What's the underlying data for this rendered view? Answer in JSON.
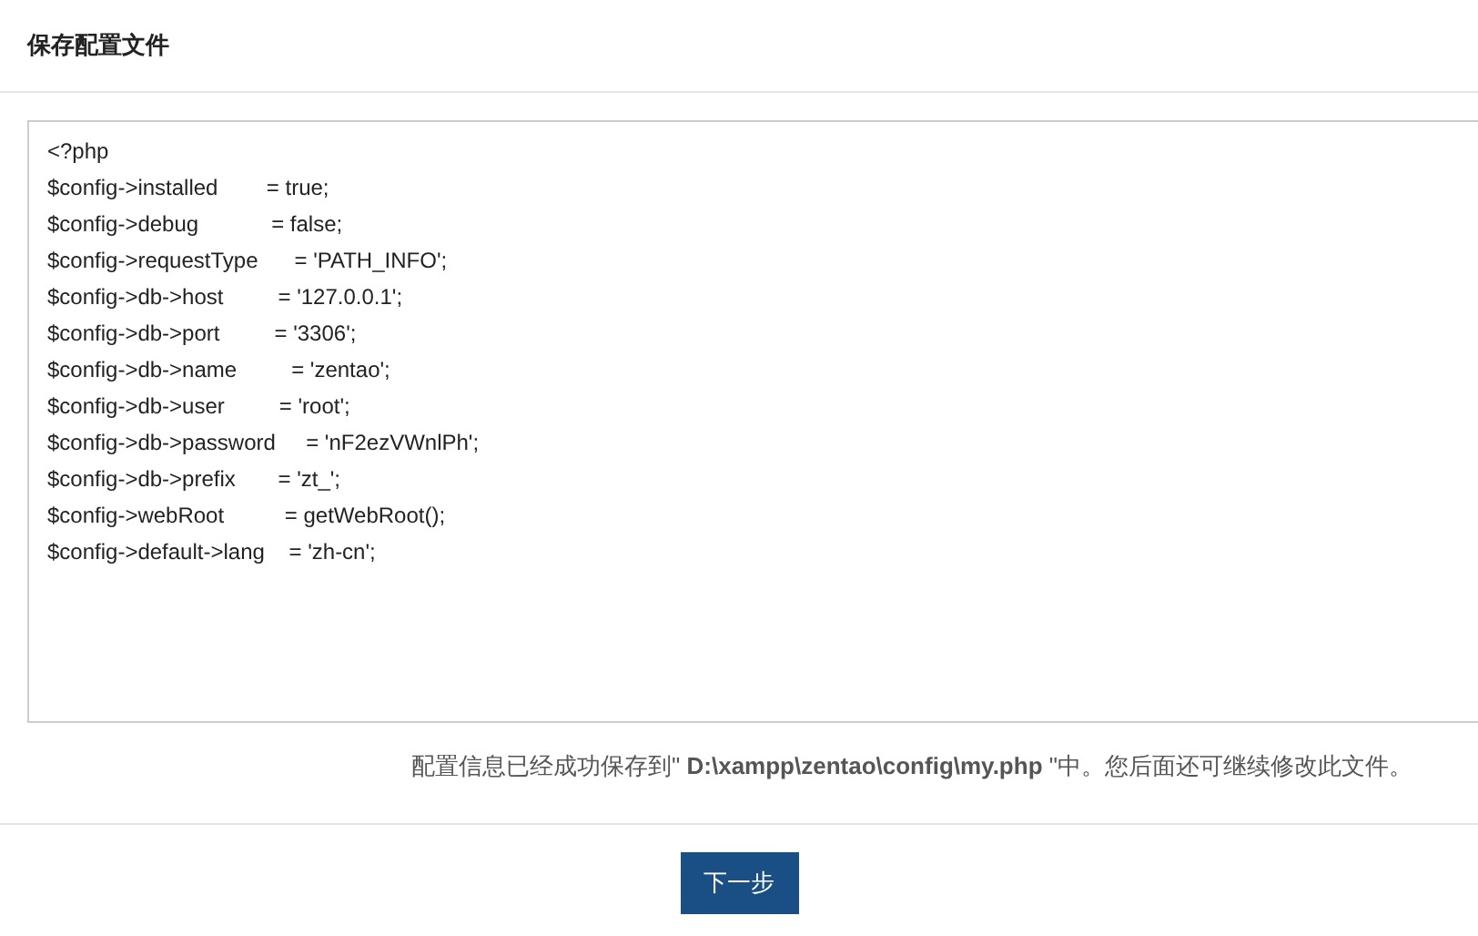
{
  "panel": {
    "title": "保存配置文件"
  },
  "config_file": {
    "lines": [
      "<?php",
      "$config->installed        = true;",
      "$config->debug            = false;",
      "$config->requestType      = 'PATH_INFO';",
      "$config->db->host         = '127.0.0.1';",
      "$config->db->port         = '3306';",
      "$config->db->name         = 'zentao';",
      "$config->db->user         = 'root';",
      "$config->db->password     = 'nF2ezVWnlPh';",
      "$config->db->prefix       = 'zt_';",
      "$config->webRoot          = getWebRoot();",
      "$config->default->lang    = 'zh-cn';"
    ]
  },
  "message": "配置信息已经成功保存到\" **D:\\xampp\\zentao\\config\\my.php** \"中。您后面还可继续修改此文件。",
  "buttons": [
    {
      "label": "下一步"
    }
  ]
}
